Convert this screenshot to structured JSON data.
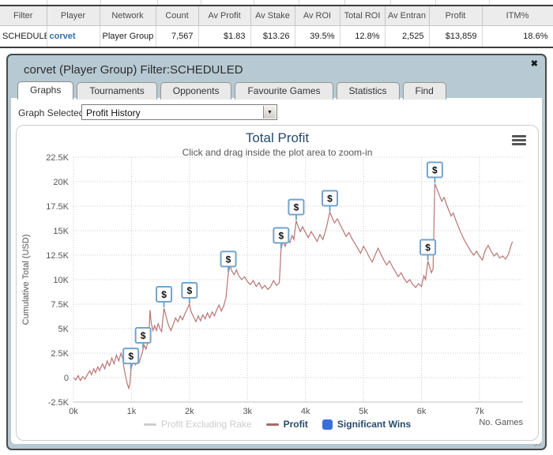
{
  "results_table": {
    "columns": [
      "Filter",
      "Player",
      "Network",
      "Count",
      "Av Profit",
      "Av Stake",
      "Av ROI",
      "Total ROI",
      "Av Entran",
      "Profit",
      "ITM%"
    ],
    "values": [
      "SCHEDULED",
      "corvet",
      "Player Group",
      "7,567",
      "$1.83",
      "$13.26",
      "39.5%",
      "12.8%",
      "2,525",
      "$13,859",
      "18.6%"
    ]
  },
  "dialog": {
    "title": "corvet (Player Group) Filter:SCHEDULED",
    "close_label": "✖",
    "tabs": [
      {
        "label": "Graphs",
        "active": true
      },
      {
        "label": "Tournaments",
        "active": false
      },
      {
        "label": "Opponents",
        "active": false
      },
      {
        "label": "Favourite Games",
        "active": false
      },
      {
        "label": "Statistics",
        "active": false
      },
      {
        "label": "Find",
        "active": false
      }
    ],
    "graph_selector": {
      "label": "Graph Selected:",
      "value": "Profit History"
    }
  },
  "chart_data": {
    "type": "line",
    "title": "Total Profit",
    "subtitle": "Click and drag inside the plot area to zoom-in",
    "ylabel": "Cumulative Total (USD)",
    "xlabel": "No. Games",
    "xlim_k": [
      0,
      7.75
    ],
    "ylim": [
      -2500,
      22500
    ],
    "x_ticks": [
      "0k",
      "1k",
      "2k",
      "3k",
      "4k",
      "5k",
      "6k",
      "7k"
    ],
    "y_ticks": [
      "22.5K",
      "20K",
      "17.5K",
      "15K",
      "12.5K",
      "10K",
      "7.5K",
      "5K",
      "2.5K",
      "0",
      "-2.5K"
    ],
    "grid": true,
    "legend_position": "bottom",
    "legend": [
      {
        "label": "Profit Excluding Rake",
        "color": "#cccccc",
        "text_color": "#cccccc",
        "type": "line",
        "disabled": true
      },
      {
        "label": "Profit",
        "color": "#a56b6b",
        "text_color": "#274b6d",
        "type": "line",
        "disabled": false
      },
      {
        "label": "Significant Wins",
        "color": "#3a6fd8",
        "text_color": "#274b6d",
        "type": "square",
        "disabled": false
      }
    ],
    "colors": {
      "line": "#b97474",
      "marker_border": "#75a3cb",
      "grid": "#cccccc",
      "axis_text": "#555555",
      "title": "#274b6d"
    },
    "marker_symbol": "$",
    "series": [
      {
        "name": "Profit",
        "points": [
          [
            0,
            0
          ],
          [
            0.04,
            -250
          ],
          [
            0.08,
            200
          ],
          [
            0.12,
            -300
          ],
          [
            0.16,
            100
          ],
          [
            0.2,
            -150
          ],
          [
            0.24,
            300
          ],
          [
            0.28,
            700
          ],
          [
            0.31,
            300
          ],
          [
            0.35,
            900
          ],
          [
            0.38,
            500
          ],
          [
            0.42,
            1100
          ],
          [
            0.45,
            700
          ],
          [
            0.5,
            1400
          ],
          [
            0.54,
            900
          ],
          [
            0.58,
            1700
          ],
          [
            0.62,
            1200
          ],
          [
            0.66,
            2000
          ],
          [
            0.7,
            1400
          ],
          [
            0.74,
            2300
          ],
          [
            0.78,
            1700
          ],
          [
            0.82,
            2500
          ],
          [
            0.85,
            1900
          ],
          [
            0.87,
            1000
          ],
          [
            0.9,
            100
          ],
          [
            0.93,
            -700
          ],
          [
            0.955,
            -1100
          ],
          [
            0.975,
            -500
          ],
          [
            0.99,
            800
          ],
          [
            1.01,
            1300
          ],
          [
            1.04,
            1600
          ],
          [
            1.07,
            1300
          ],
          [
            1.1,
            1800
          ],
          [
            1.13,
            1500
          ],
          [
            1.16,
            2100
          ],
          [
            1.18,
            2400
          ],
          [
            1.2,
            2900
          ],
          [
            1.22,
            3300
          ],
          [
            1.25,
            2900
          ],
          [
            1.28,
            3600
          ],
          [
            1.3,
            4200
          ],
          [
            1.32,
            6900
          ],
          [
            1.34,
            5600
          ],
          [
            1.37,
            4800
          ],
          [
            1.4,
            5300
          ],
          [
            1.43,
            4800
          ],
          [
            1.46,
            5500
          ],
          [
            1.49,
            5000
          ],
          [
            1.52,
            4700
          ],
          [
            1.56,
            7100
          ],
          [
            1.59,
            6400
          ],
          [
            1.62,
            5700
          ],
          [
            1.65,
            5200
          ],
          [
            1.68,
            4800
          ],
          [
            1.72,
            5400
          ],
          [
            1.76,
            6100
          ],
          [
            1.8,
            5700
          ],
          [
            1.84,
            6300
          ],
          [
            1.88,
            5900
          ],
          [
            1.92,
            6500
          ],
          [
            1.96,
            7000
          ],
          [
            2.0,
            7500
          ],
          [
            2.03,
            6700
          ],
          [
            2.07,
            6200
          ],
          [
            2.11,
            5700
          ],
          [
            2.15,
            6300
          ],
          [
            2.19,
            5800
          ],
          [
            2.23,
            6400
          ],
          [
            2.27,
            6000
          ],
          [
            2.31,
            6600
          ],
          [
            2.35,
            6100
          ],
          [
            2.39,
            6700
          ],
          [
            2.43,
            6300
          ],
          [
            2.47,
            6900
          ],
          [
            2.51,
            7400
          ],
          [
            2.55,
            6800
          ],
          [
            2.59,
            7300
          ],
          [
            2.63,
            8200
          ],
          [
            2.67,
            10700
          ],
          [
            2.7,
            11400
          ],
          [
            2.73,
            10900
          ],
          [
            2.77,
            10500
          ],
          [
            2.81,
            11000
          ],
          [
            2.85,
            10400
          ],
          [
            2.9,
            10000
          ],
          [
            2.95,
            10300
          ],
          [
            3.0,
            9800
          ],
          [
            3.05,
            9500
          ],
          [
            3.1,
            9900
          ],
          [
            3.15,
            9300
          ],
          [
            3.2,
            9700
          ],
          [
            3.25,
            9100
          ],
          [
            3.3,
            9400
          ],
          [
            3.35,
            9000
          ],
          [
            3.4,
            9300
          ],
          [
            3.45,
            9900
          ],
          [
            3.5,
            9400
          ],
          [
            3.55,
            9700
          ],
          [
            3.58,
            13100
          ],
          [
            3.61,
            13900
          ],
          [
            3.65,
            13400
          ],
          [
            3.69,
            14200
          ],
          [
            3.73,
            13800
          ],
          [
            3.77,
            14500
          ],
          [
            3.8,
            14100
          ],
          [
            3.84,
            16000
          ],
          [
            3.87,
            15500
          ],
          [
            3.91,
            14900
          ],
          [
            3.95,
            15400
          ],
          [
            4.0,
            14800
          ],
          [
            4.05,
            14300
          ],
          [
            4.1,
            14900
          ],
          [
            4.15,
            14400
          ],
          [
            4.2,
            13900
          ],
          [
            4.25,
            14600
          ],
          [
            4.3,
            14100
          ],
          [
            4.36,
            15300
          ],
          [
            4.42,
            16900
          ],
          [
            4.46,
            16300
          ],
          [
            4.5,
            15800
          ],
          [
            4.55,
            16200
          ],
          [
            4.6,
            15600
          ],
          [
            4.65,
            15000
          ],
          [
            4.7,
            14400
          ],
          [
            4.75,
            14800
          ],
          [
            4.8,
            14200
          ],
          [
            4.85,
            13700
          ],
          [
            4.9,
            13200
          ],
          [
            4.95,
            12700
          ],
          [
            5.0,
            13400
          ],
          [
            5.05,
            12900
          ],
          [
            5.1,
            12300
          ],
          [
            5.15,
            11800
          ],
          [
            5.2,
            12500
          ],
          [
            5.25,
            13200
          ],
          [
            5.3,
            12600
          ],
          [
            5.35,
            12000
          ],
          [
            5.4,
            11500
          ],
          [
            5.45,
            11900
          ],
          [
            5.5,
            11300
          ],
          [
            5.55,
            10800
          ],
          [
            5.6,
            10300
          ],
          [
            5.65,
            10700
          ],
          [
            5.7,
            10100
          ],
          [
            5.75,
            9700
          ],
          [
            5.8,
            10000
          ],
          [
            5.85,
            9500
          ],
          [
            5.9,
            9200
          ],
          [
            5.95,
            9600
          ],
          [
            6.0,
            9300
          ],
          [
            6.04,
            10400
          ],
          [
            6.07,
            10000
          ],
          [
            6.11,
            11900
          ],
          [
            6.14,
            11300
          ],
          [
            6.17,
            10700
          ],
          [
            6.2,
            11100
          ],
          [
            6.23,
            19800
          ],
          [
            6.27,
            19200
          ],
          [
            6.31,
            18600
          ],
          [
            6.35,
            18000
          ],
          [
            6.39,
            18400
          ],
          [
            6.43,
            17700
          ],
          [
            6.47,
            17100
          ],
          [
            6.51,
            16500
          ],
          [
            6.55,
            16800
          ],
          [
            6.59,
            16100
          ],
          [
            6.63,
            15500
          ],
          [
            6.67,
            14900
          ],
          [
            6.71,
            14400
          ],
          [
            6.75,
            13900
          ],
          [
            6.8,
            13400
          ],
          [
            6.85,
            12900
          ],
          [
            6.9,
            12500
          ],
          [
            6.95,
            12900
          ],
          [
            7.0,
            12400
          ],
          [
            7.05,
            12000
          ],
          [
            7.1,
            13000
          ],
          [
            7.15,
            13500
          ],
          [
            7.2,
            12900
          ],
          [
            7.25,
            12400
          ],
          [
            7.3,
            12700
          ],
          [
            7.35,
            12200
          ],
          [
            7.4,
            12400
          ],
          [
            7.45,
            12100
          ],
          [
            7.5,
            12600
          ],
          [
            7.55,
            13600
          ],
          [
            7.57,
            13859
          ]
        ]
      }
    ],
    "significant_wins": [
      [
        0.99,
        800
      ],
      [
        1.2,
        2900
      ],
      [
        1.56,
        7100
      ],
      [
        2.0,
        7500
      ],
      [
        2.67,
        10700
      ],
      [
        3.58,
        13100
      ],
      [
        3.84,
        16000
      ],
      [
        4.42,
        16900
      ],
      [
        6.11,
        11900
      ],
      [
        6.23,
        19800
      ]
    ]
  }
}
